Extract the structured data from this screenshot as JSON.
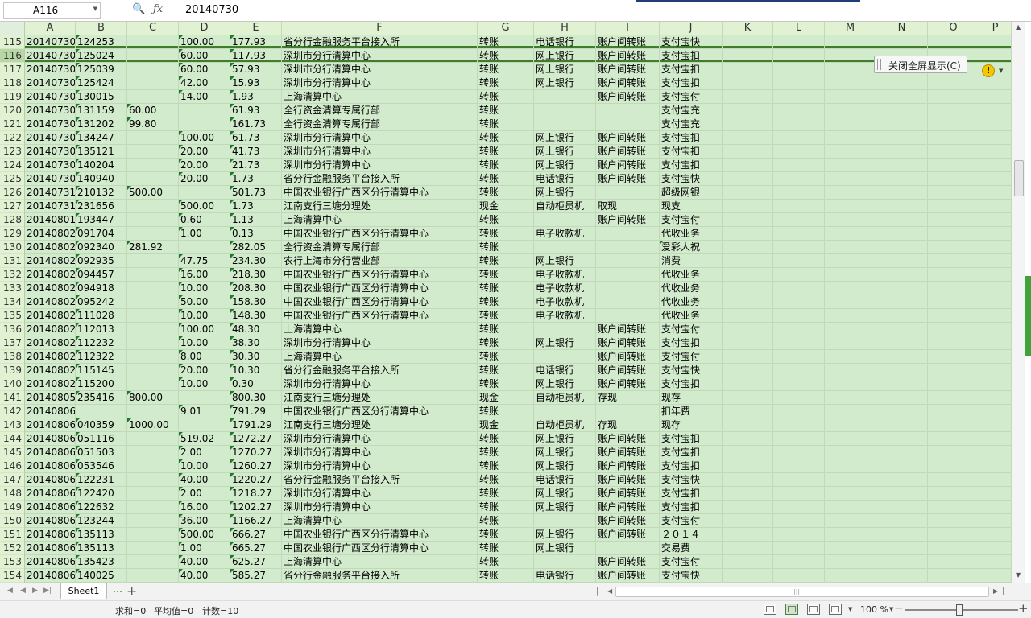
{
  "formula_bar": {
    "name_box": "A116",
    "value": "20140730"
  },
  "columns": [
    "A",
    "B",
    "C",
    "D",
    "E",
    "F",
    "G",
    "H",
    "I",
    "J",
    "K",
    "L",
    "M",
    "N",
    "O",
    "P"
  ],
  "rows": [
    {
      "n": "115",
      "a": "20140730",
      "b": "124253",
      "c": "",
      "d": "100.00",
      "e": "177.93",
      "f": "省分行金融服务平台接入所",
      "g": "转账",
      "h": "电话银行",
      "i": "账户间转账",
      "j": "支付宝快"
    },
    {
      "n": "116",
      "a": "20140730",
      "b": "125024",
      "c": "",
      "d": "60.00",
      "e": "117.93",
      "f": "深圳市分行清算中心",
      "g": "转账",
      "h": "网上银行",
      "i": "账户间转账",
      "j": "支付宝扣"
    },
    {
      "n": "117",
      "a": "20140730",
      "b": "125039",
      "c": "",
      "d": "60.00",
      "e": "57.93",
      "f": "深圳市分行清算中心",
      "g": "转账",
      "h": "网上银行",
      "i": "账户间转账",
      "j": "支付宝扣"
    },
    {
      "n": "118",
      "a": "20140730",
      "b": "125424",
      "c": "",
      "d": "42.00",
      "e": "15.93",
      "f": "深圳市分行清算中心",
      "g": "转账",
      "h": "网上银行",
      "i": "账户间转账",
      "j": "支付宝扣"
    },
    {
      "n": "119",
      "a": "20140730",
      "b": "130015",
      "c": "",
      "d": "14.00",
      "e": "1.93",
      "f": "上海清算中心",
      "g": "转账",
      "h": "",
      "i": "账户间转账",
      "j": "支付宝付"
    },
    {
      "n": "120",
      "a": "20140730",
      "b": "131159",
      "c": "60.00",
      "d": "",
      "e": "61.93",
      "f": "全行资金清算专属行部",
      "g": "转账",
      "h": "",
      "i": "",
      "j": "支付宝充"
    },
    {
      "n": "121",
      "a": "20140730",
      "b": "131202",
      "c": "99.80",
      "d": "",
      "e": "161.73",
      "f": "全行资金清算专属行部",
      "g": "转账",
      "h": "",
      "i": "",
      "j": "支付宝充"
    },
    {
      "n": "122",
      "a": "20140730",
      "b": "134247",
      "c": "",
      "d": "100.00",
      "e": "61.73",
      "f": "深圳市分行清算中心",
      "g": "转账",
      "h": "网上银行",
      "i": "账户间转账",
      "j": "支付宝扣"
    },
    {
      "n": "123",
      "a": "20140730",
      "b": "135121",
      "c": "",
      "d": "20.00",
      "e": "41.73",
      "f": "深圳市分行清算中心",
      "g": "转账",
      "h": "网上银行",
      "i": "账户间转账",
      "j": "支付宝扣"
    },
    {
      "n": "124",
      "a": "20140730",
      "b": "140204",
      "c": "",
      "d": "20.00",
      "e": "21.73",
      "f": "深圳市分行清算中心",
      "g": "转账",
      "h": "网上银行",
      "i": "账户间转账",
      "j": "支付宝扣"
    },
    {
      "n": "125",
      "a": "20140730",
      "b": "140940",
      "c": "",
      "d": "20.00",
      "e": "1.73",
      "f": "省分行金融服务平台接入所",
      "g": "转账",
      "h": "电话银行",
      "i": "账户间转账",
      "j": "支付宝快"
    },
    {
      "n": "126",
      "a": "20140731",
      "b": "210132",
      "c": "500.00",
      "d": "",
      "e": "501.73",
      "f": "中国农业银行广西区分行清算中心",
      "g": "转账",
      "h": "网上银行",
      "i": "",
      "j": "超级网银"
    },
    {
      "n": "127",
      "a": "20140731",
      "b": "231656",
      "c": "",
      "d": "500.00",
      "e": "1.73",
      "f": "江南支行三塘分理处",
      "g": "现金",
      "h": "自动柜员机",
      "i": "取现",
      "j": "现支"
    },
    {
      "n": "128",
      "a": "20140801",
      "b": "193447",
      "c": "",
      "d": "0.60",
      "e": "1.13",
      "f": "上海清算中心",
      "g": "转账",
      "h": "",
      "i": "账户间转账",
      "j": "支付宝付"
    },
    {
      "n": "129",
      "a": "20140802",
      "b": "091704",
      "c": "",
      "d": "1.00",
      "e": "0.13",
      "f": "中国农业银行广西区分行清算中心",
      "g": "转账",
      "h": "电子收款机",
      "i": "",
      "j": "代收业务"
    },
    {
      "n": "130",
      "a": "20140802",
      "b": "092340",
      "c": "281.92",
      "d": "",
      "e": "282.05",
      "f": "全行资金清算专属行部",
      "g": "转账",
      "h": "",
      "i": "",
      "j": "爱彩人祝"
    },
    {
      "n": "131",
      "a": "20140802",
      "b": "092935",
      "c": "",
      "d": "47.75",
      "e": "234.30",
      "f": "农行上海市分行营业部",
      "g": "转账",
      "h": "网上银行",
      "i": "",
      "j": "消费"
    },
    {
      "n": "132",
      "a": "20140802",
      "b": "094457",
      "c": "",
      "d": "16.00",
      "e": "218.30",
      "f": "中国农业银行广西区分行清算中心",
      "g": "转账",
      "h": "电子收款机",
      "i": "",
      "j": "代收业务"
    },
    {
      "n": "133",
      "a": "20140802",
      "b": "094918",
      "c": "",
      "d": "10.00",
      "e": "208.30",
      "f": "中国农业银行广西区分行清算中心",
      "g": "转账",
      "h": "电子收款机",
      "i": "",
      "j": "代收业务"
    },
    {
      "n": "134",
      "a": "20140802",
      "b": "095242",
      "c": "",
      "d": "50.00",
      "e": "158.30",
      "f": "中国农业银行广西区分行清算中心",
      "g": "转账",
      "h": "电子收款机",
      "i": "",
      "j": "代收业务"
    },
    {
      "n": "135",
      "a": "20140802",
      "b": "111028",
      "c": "",
      "d": "10.00",
      "e": "148.30",
      "f": "中国农业银行广西区分行清算中心",
      "g": "转账",
      "h": "电子收款机",
      "i": "",
      "j": "代收业务"
    },
    {
      "n": "136",
      "a": "20140802",
      "b": "112013",
      "c": "",
      "d": "100.00",
      "e": "48.30",
      "f": "上海清算中心",
      "g": "转账",
      "h": "",
      "i": "账户间转账",
      "j": "支付宝付"
    },
    {
      "n": "137",
      "a": "20140802",
      "b": "112232",
      "c": "",
      "d": "10.00",
      "e": "38.30",
      "f": "深圳市分行清算中心",
      "g": "转账",
      "h": "网上银行",
      "i": "账户间转账",
      "j": "支付宝扣"
    },
    {
      "n": "138",
      "a": "20140802",
      "b": "112322",
      "c": "",
      "d": "8.00",
      "e": "30.30",
      "f": "上海清算中心",
      "g": "转账",
      "h": "",
      "i": "账户间转账",
      "j": "支付宝付"
    },
    {
      "n": "139",
      "a": "20140802",
      "b": "115145",
      "c": "",
      "d": "20.00",
      "e": "10.30",
      "f": "省分行金融服务平台接入所",
      "g": "转账",
      "h": "电话银行",
      "i": "账户间转账",
      "j": "支付宝快"
    },
    {
      "n": "140",
      "a": "20140802",
      "b": "115200",
      "c": "",
      "d": "10.00",
      "e": "0.30",
      "f": "深圳市分行清算中心",
      "g": "转账",
      "h": "网上银行",
      "i": "账户间转账",
      "j": "支付宝扣"
    },
    {
      "n": "141",
      "a": "20140805",
      "b": "235416",
      "c": "800.00",
      "d": "",
      "e": "800.30",
      "f": "江南支行三塘分理处",
      "g": "现金",
      "h": "自动柜员机",
      "i": "存现",
      "j": "现存"
    },
    {
      "n": "142",
      "a": "20140806",
      "b": "",
      "c": "",
      "d": "9.01",
      "e": "791.29",
      "f": "中国农业银行广西区分行清算中心",
      "g": "转账",
      "h": "",
      "i": "",
      "j": "扣年费"
    },
    {
      "n": "143",
      "a": "20140806",
      "b": "040359",
      "c": "1000.00",
      "d": "",
      "e": "1791.29",
      "f": "江南支行三塘分理处",
      "g": "现金",
      "h": "自动柜员机",
      "i": "存现",
      "j": "现存"
    },
    {
      "n": "144",
      "a": "20140806",
      "b": "051116",
      "c": "",
      "d": "519.02",
      "e": "1272.27",
      "f": "深圳市分行清算中心",
      "g": "转账",
      "h": "网上银行",
      "i": "账户间转账",
      "j": "支付宝扣"
    },
    {
      "n": "145",
      "a": "20140806",
      "b": "051503",
      "c": "",
      "d": "2.00",
      "e": "1270.27",
      "f": "深圳市分行清算中心",
      "g": "转账",
      "h": "网上银行",
      "i": "账户间转账",
      "j": "支付宝扣"
    },
    {
      "n": "146",
      "a": "20140806",
      "b": "053546",
      "c": "",
      "d": "10.00",
      "e": "1260.27",
      "f": "深圳市分行清算中心",
      "g": "转账",
      "h": "网上银行",
      "i": "账户间转账",
      "j": "支付宝扣"
    },
    {
      "n": "147",
      "a": "20140806",
      "b": "122231",
      "c": "",
      "d": "40.00",
      "e": "1220.27",
      "f": "省分行金融服务平台接入所",
      "g": "转账",
      "h": "电话银行",
      "i": "账户间转账",
      "j": "支付宝快"
    },
    {
      "n": "148",
      "a": "20140806",
      "b": "122420",
      "c": "",
      "d": "2.00",
      "e": "1218.27",
      "f": "深圳市分行清算中心",
      "g": "转账",
      "h": "网上银行",
      "i": "账户间转账",
      "j": "支付宝扣"
    },
    {
      "n": "149",
      "a": "20140806",
      "b": "122632",
      "c": "",
      "d": "16.00",
      "e": "1202.27",
      "f": "深圳市分行清算中心",
      "g": "转账",
      "h": "网上银行",
      "i": "账户间转账",
      "j": "支付宝扣"
    },
    {
      "n": "150",
      "a": "20140806",
      "b": "123244",
      "c": "",
      "d": "36.00",
      "e": "1166.27",
      "f": "上海清算中心",
      "g": "转账",
      "h": "",
      "i": "账户间转账",
      "j": "支付宝付"
    },
    {
      "n": "151",
      "a": "20140806",
      "b": "135113",
      "c": "",
      "d": "500.00",
      "e": "666.27",
      "f": "中国农业银行广西区分行清算中心",
      "g": "转账",
      "h": "网上银行",
      "i": "账户间转账",
      "j": "２０１４"
    },
    {
      "n": "152",
      "a": "20140806",
      "b": "135113",
      "c": "",
      "d": "1.00",
      "e": "665.27",
      "f": "中国农业银行广西区分行清算中心",
      "g": "转账",
      "h": "网上银行",
      "i": "",
      "j": "交易费"
    },
    {
      "n": "153",
      "a": "20140806",
      "b": "135423",
      "c": "",
      "d": "40.00",
      "e": "625.27",
      "f": "上海清算中心",
      "g": "转账",
      "h": "",
      "i": "账户间转账",
      "j": "支付宝付"
    },
    {
      "n": "154",
      "a": "20140806",
      "b": "140025",
      "c": "",
      "d": "40.00",
      "e": "585.27",
      "f": "省分行金融服务平台接入所",
      "g": "转账",
      "h": "电话银行",
      "i": "账户间转账",
      "j": "支付宝快"
    }
  ],
  "popup": {
    "close_fullscreen_label": "关闭全屏显示(C)"
  },
  "warning_icon_glyph": "!",
  "sheet_tabs": [
    "Sheet1"
  ],
  "status": {
    "sum": "求和=0",
    "average": "平均值=0",
    "count": "计数=10"
  },
  "zoom": {
    "label": "100 %",
    "percent": 100
  },
  "colors": {
    "grid_bg": "#d3ebcd",
    "header_bg": "#e1f2d2",
    "selection_border": "#3e7d2a",
    "text_marker": "#1e7a2a"
  }
}
